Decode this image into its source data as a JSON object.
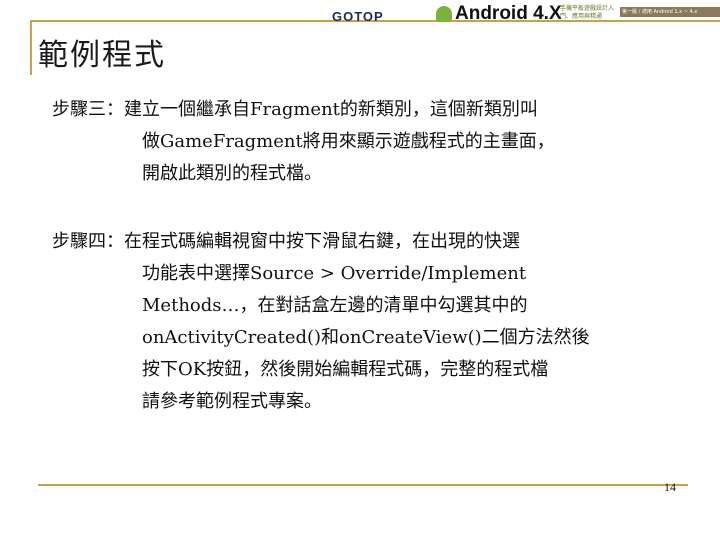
{
  "header": {
    "brand_gotop": "GOTOP",
    "brand_android": "Android 4.X",
    "brand_sub": "手機平板遊戲設計入門、應用與精通",
    "brand_badge": "第一版 / 適用 Android 1.x ~ 4.x"
  },
  "slide": {
    "title": "範例程式",
    "steps": [
      {
        "lines": [
          "步驟三：建立一個繼承自Fragment的新類別，這個新類別叫",
          "做GameFragment將用來顯示遊戲程式的主畫面，",
          "開啟此類別的程式檔。"
        ]
      },
      {
        "lines": [
          "步驟四：在程式碼編輯視窗中按下滑鼠右鍵，在出現的快選",
          "功能表中選擇Source > Override/Implement",
          "Methods…，在對話盒左邊的清單中勾選其中的",
          "onActivityCreated()和onCreateView()二個方法然後",
          "按下OK按鈕，然後開始編輯程式碼，完整的程式檔",
          "請參考範例程式專案。"
        ]
      }
    ]
  },
  "footer": {
    "page_number": "14"
  }
}
